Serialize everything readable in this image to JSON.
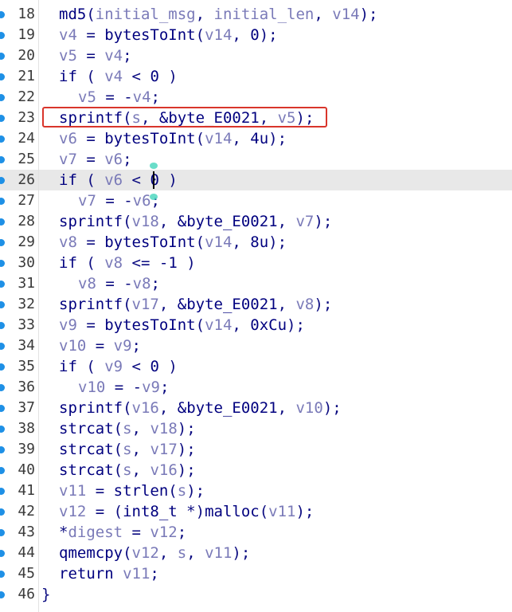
{
  "editor": {
    "current_line": 26,
    "highlighted_line": 23,
    "lines": [
      {
        "num": "18",
        "bp": true,
        "indent": 1,
        "tokens": [
          [
            "fn",
            "md5"
          ],
          [
            "p",
            "("
          ],
          [
            "v",
            "initial_msg"
          ],
          [
            "p",
            ", "
          ],
          [
            "v",
            "initial_len"
          ],
          [
            "p",
            ", "
          ],
          [
            "v",
            "v14"
          ],
          [
            "p",
            ");"
          ]
        ]
      },
      {
        "num": "19",
        "bp": true,
        "indent": 1,
        "tokens": [
          [
            "v",
            "v4"
          ],
          [
            "p",
            " = "
          ],
          [
            "fn",
            "bytesToInt"
          ],
          [
            "p",
            "("
          ],
          [
            "v",
            "v14"
          ],
          [
            "p",
            ", "
          ],
          [
            "n",
            "0"
          ],
          [
            "p",
            ");"
          ]
        ]
      },
      {
        "num": "20",
        "bp": true,
        "indent": 1,
        "tokens": [
          [
            "v",
            "v5"
          ],
          [
            "p",
            " = "
          ],
          [
            "v",
            "v4"
          ],
          [
            "p",
            ";"
          ]
        ]
      },
      {
        "num": "21",
        "bp": true,
        "indent": 1,
        "tokens": [
          [
            "k",
            "if"
          ],
          [
            "p",
            " ( "
          ],
          [
            "v",
            "v4"
          ],
          [
            "p",
            " < "
          ],
          [
            "n",
            "0"
          ],
          [
            "p",
            " )"
          ]
        ]
      },
      {
        "num": "22",
        "bp": true,
        "indent": 2,
        "tokens": [
          [
            "v",
            "v5"
          ],
          [
            "p",
            " = -"
          ],
          [
            "v",
            "v4"
          ],
          [
            "p",
            ";"
          ]
        ]
      },
      {
        "num": "23",
        "bp": true,
        "indent": 1,
        "tokens": [
          [
            "fn",
            "sprintf"
          ],
          [
            "p",
            "("
          ],
          [
            "v",
            "s"
          ],
          [
            "p",
            ", "
          ],
          [
            "s",
            "&byte_E0021"
          ],
          [
            "p",
            ", "
          ],
          [
            "v",
            "v5"
          ],
          [
            "p",
            ");"
          ]
        ]
      },
      {
        "num": "24",
        "bp": true,
        "indent": 1,
        "tokens": [
          [
            "v",
            "v6"
          ],
          [
            "p",
            " = "
          ],
          [
            "fn",
            "bytesToInt"
          ],
          [
            "p",
            "("
          ],
          [
            "v",
            "v14"
          ],
          [
            "p",
            ", "
          ],
          [
            "n",
            "4u"
          ],
          [
            "p",
            ");"
          ]
        ]
      },
      {
        "num": "25",
        "bp": true,
        "indent": 1,
        "tokens": [
          [
            "v",
            "v7"
          ],
          [
            "p",
            " = "
          ],
          [
            "v",
            "v6"
          ],
          [
            "p",
            ";"
          ]
        ]
      },
      {
        "num": "26",
        "bp": true,
        "indent": 1,
        "tokens": [
          [
            "k",
            "if"
          ],
          [
            "p",
            " ( "
          ],
          [
            "v",
            "v6"
          ],
          [
            "p",
            " < "
          ],
          [
            "n",
            "0"
          ],
          [
            "p",
            " )"
          ]
        ]
      },
      {
        "num": "27",
        "bp": true,
        "indent": 2,
        "tokens": [
          [
            "v",
            "v7"
          ],
          [
            "p",
            " = -"
          ],
          [
            "v",
            "v6"
          ],
          [
            "p",
            ";"
          ]
        ]
      },
      {
        "num": "28",
        "bp": true,
        "indent": 1,
        "tokens": [
          [
            "fn",
            "sprintf"
          ],
          [
            "p",
            "("
          ],
          [
            "v",
            "v18"
          ],
          [
            "p",
            ", "
          ],
          [
            "s",
            "&byte_E0021"
          ],
          [
            "p",
            ", "
          ],
          [
            "v",
            "v7"
          ],
          [
            "p",
            ");"
          ]
        ]
      },
      {
        "num": "29",
        "bp": true,
        "indent": 1,
        "tokens": [
          [
            "v",
            "v8"
          ],
          [
            "p",
            " = "
          ],
          [
            "fn",
            "bytesToInt"
          ],
          [
            "p",
            "("
          ],
          [
            "v",
            "v14"
          ],
          [
            "p",
            ", "
          ],
          [
            "n",
            "8u"
          ],
          [
            "p",
            ");"
          ]
        ]
      },
      {
        "num": "30",
        "bp": true,
        "indent": 1,
        "tokens": [
          [
            "k",
            "if"
          ],
          [
            "p",
            " ( "
          ],
          [
            "v",
            "v8"
          ],
          [
            "p",
            " <= "
          ],
          [
            "n",
            "-1"
          ],
          [
            "p",
            " )"
          ]
        ]
      },
      {
        "num": "31",
        "bp": true,
        "indent": 2,
        "tokens": [
          [
            "v",
            "v8"
          ],
          [
            "p",
            " = -"
          ],
          [
            "v",
            "v8"
          ],
          [
            "p",
            ";"
          ]
        ]
      },
      {
        "num": "32",
        "bp": true,
        "indent": 1,
        "tokens": [
          [
            "fn",
            "sprintf"
          ],
          [
            "p",
            "("
          ],
          [
            "v",
            "v17"
          ],
          [
            "p",
            ", "
          ],
          [
            "s",
            "&byte_E0021"
          ],
          [
            "p",
            ", "
          ],
          [
            "v",
            "v8"
          ],
          [
            "p",
            ");"
          ]
        ]
      },
      {
        "num": "33",
        "bp": true,
        "indent": 1,
        "tokens": [
          [
            "v",
            "v9"
          ],
          [
            "p",
            " = "
          ],
          [
            "fn",
            "bytesToInt"
          ],
          [
            "p",
            "("
          ],
          [
            "v",
            "v14"
          ],
          [
            "p",
            ", "
          ],
          [
            "n",
            "0xCu"
          ],
          [
            "p",
            ");"
          ]
        ]
      },
      {
        "num": "34",
        "bp": true,
        "indent": 1,
        "tokens": [
          [
            "v",
            "v10"
          ],
          [
            "p",
            " = "
          ],
          [
            "v",
            "v9"
          ],
          [
            "p",
            ";"
          ]
        ]
      },
      {
        "num": "35",
        "bp": true,
        "indent": 1,
        "tokens": [
          [
            "k",
            "if"
          ],
          [
            "p",
            " ( "
          ],
          [
            "v",
            "v9"
          ],
          [
            "p",
            " < "
          ],
          [
            "n",
            "0"
          ],
          [
            "p",
            " )"
          ]
        ]
      },
      {
        "num": "36",
        "bp": true,
        "indent": 2,
        "tokens": [
          [
            "v",
            "v10"
          ],
          [
            "p",
            " = -"
          ],
          [
            "v",
            "v9"
          ],
          [
            "p",
            ";"
          ]
        ]
      },
      {
        "num": "37",
        "bp": true,
        "indent": 1,
        "tokens": [
          [
            "fn",
            "sprintf"
          ],
          [
            "p",
            "("
          ],
          [
            "v",
            "v16"
          ],
          [
            "p",
            ", "
          ],
          [
            "s",
            "&byte_E0021"
          ],
          [
            "p",
            ", "
          ],
          [
            "v",
            "v10"
          ],
          [
            "p",
            ");"
          ]
        ]
      },
      {
        "num": "38",
        "bp": true,
        "indent": 1,
        "tokens": [
          [
            "fn",
            "strcat"
          ],
          [
            "p",
            "("
          ],
          [
            "v",
            "s"
          ],
          [
            "p",
            ", "
          ],
          [
            "v",
            "v18"
          ],
          [
            "p",
            ");"
          ]
        ]
      },
      {
        "num": "39",
        "bp": true,
        "indent": 1,
        "tokens": [
          [
            "fn",
            "strcat"
          ],
          [
            "p",
            "("
          ],
          [
            "v",
            "s"
          ],
          [
            "p",
            ", "
          ],
          [
            "v",
            "v17"
          ],
          [
            "p",
            ");"
          ]
        ]
      },
      {
        "num": "40",
        "bp": true,
        "indent": 1,
        "tokens": [
          [
            "fn",
            "strcat"
          ],
          [
            "p",
            "("
          ],
          [
            "v",
            "s"
          ],
          [
            "p",
            ", "
          ],
          [
            "v",
            "v16"
          ],
          [
            "p",
            ");"
          ]
        ]
      },
      {
        "num": "41",
        "bp": true,
        "indent": 1,
        "tokens": [
          [
            "v",
            "v11"
          ],
          [
            "p",
            " = "
          ],
          [
            "fn",
            "strlen"
          ],
          [
            "p",
            "("
          ],
          [
            "v",
            "s"
          ],
          [
            "p",
            ");"
          ]
        ]
      },
      {
        "num": "42",
        "bp": true,
        "indent": 1,
        "tokens": [
          [
            "v",
            "v12"
          ],
          [
            "p",
            " = ("
          ],
          [
            "t",
            "int8_t"
          ],
          [
            "p",
            " *)"
          ],
          [
            "fn",
            "malloc"
          ],
          [
            "p",
            "("
          ],
          [
            "v",
            "v11"
          ],
          [
            "p",
            ");"
          ]
        ]
      },
      {
        "num": "43",
        "bp": true,
        "indent": 1,
        "tokens": [
          [
            "p",
            "*"
          ],
          [
            "v",
            "digest"
          ],
          [
            "p",
            " = "
          ],
          [
            "v",
            "v12"
          ],
          [
            "p",
            ";"
          ]
        ]
      },
      {
        "num": "44",
        "bp": true,
        "indent": 1,
        "tokens": [
          [
            "fn",
            "qmemcpy"
          ],
          [
            "p",
            "("
          ],
          [
            "v",
            "v12"
          ],
          [
            "p",
            ", "
          ],
          [
            "v",
            "s"
          ],
          [
            "p",
            ", "
          ],
          [
            "v",
            "v11"
          ],
          [
            "p",
            ");"
          ]
        ]
      },
      {
        "num": "45",
        "bp": true,
        "indent": 1,
        "tokens": [
          [
            "k",
            "return"
          ],
          [
            "p",
            " "
          ],
          [
            "v",
            "v11"
          ],
          [
            "p",
            ";"
          ]
        ]
      },
      {
        "num": "46",
        "bp": true,
        "indent": 0,
        "tokens": [
          [
            "p",
            "}"
          ]
        ]
      }
    ]
  },
  "icons": {
    "breakpoint": "breakpoint-dot-icon"
  },
  "colors": {
    "highlight_box": "#d9352b",
    "current_line_bg": "#e8e8e8",
    "breakpoint": "#1e90e6",
    "identifier": "#00007f",
    "variable": "#7a7ab8"
  }
}
